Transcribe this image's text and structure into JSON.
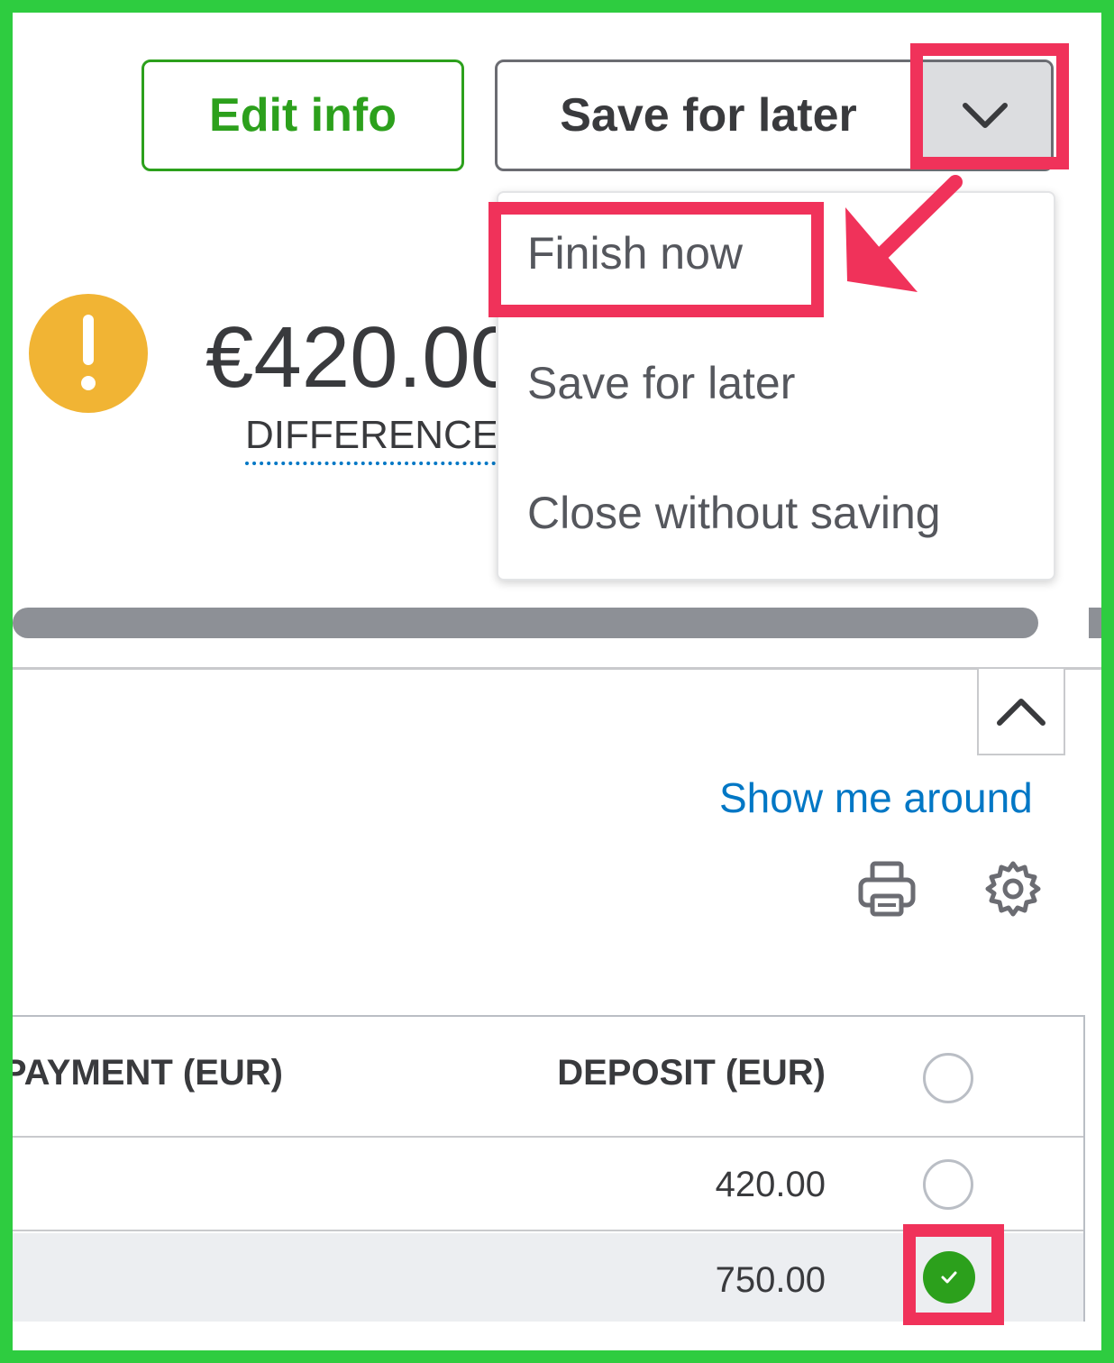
{
  "toolbar": {
    "edit_info_label": "Edit info",
    "save_for_later_label": "Save for later",
    "dropdown_icon": "chevron-down-icon"
  },
  "dropdown_menu": {
    "items": [
      {
        "label": "Finish now"
      },
      {
        "label": "Save for later"
      },
      {
        "label": "Close without saving"
      }
    ]
  },
  "summary": {
    "amount": "€420.00",
    "label": "DIFFERENCE",
    "status_icon": "warning-icon"
  },
  "panel": {
    "show_me_around": "Show me around",
    "print_icon": "print-icon",
    "settings_icon": "gear-icon"
  },
  "table": {
    "columns": [
      "PAYMENT (EUR)",
      "DEPOSIT (EUR)"
    ],
    "rows": [
      {
        "deposit": "420.00",
        "checked": false
      },
      {
        "deposit": "750.00",
        "checked": true
      }
    ]
  },
  "colors": {
    "frame": "#2ecc40",
    "highlight": "#f0325a",
    "brand_green": "#2ca01c",
    "link_blue": "#0077c5",
    "warning": "#f1b434"
  }
}
